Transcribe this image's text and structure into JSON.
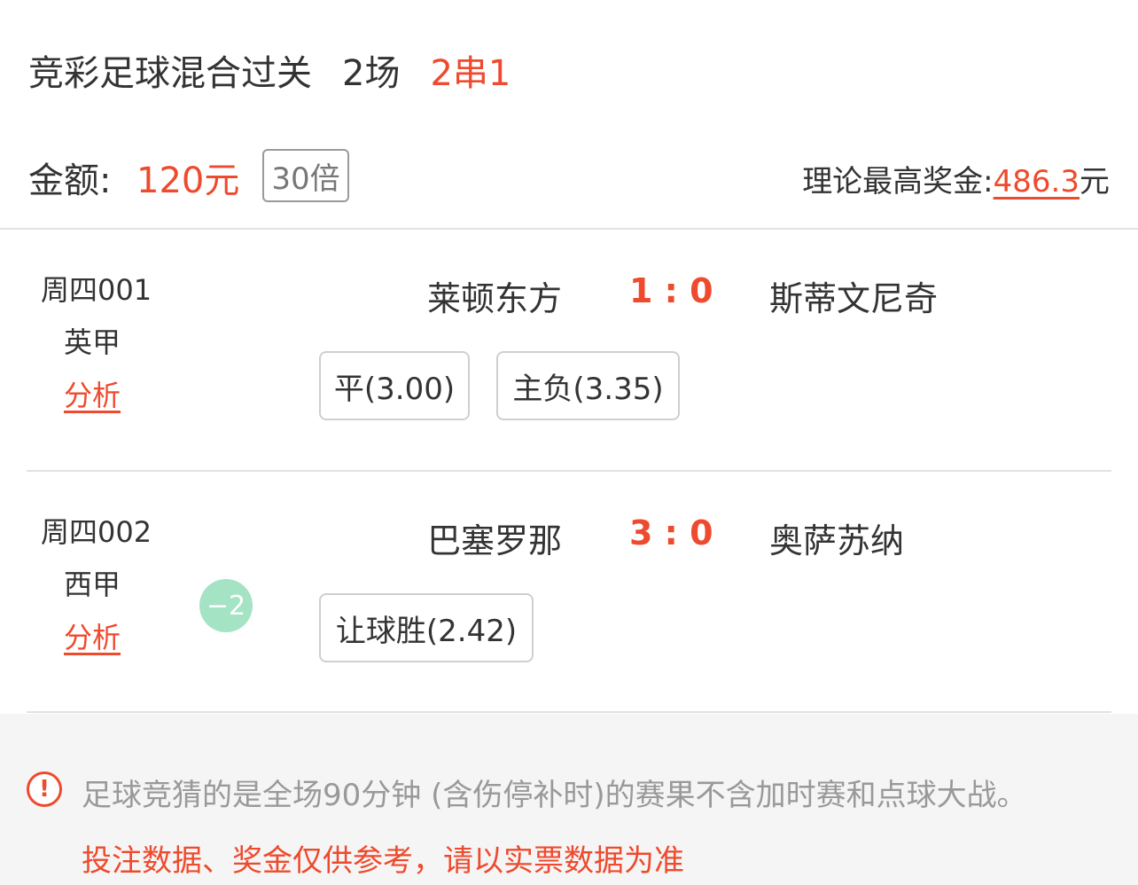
{
  "header": {
    "title": "竞彩足球混合过关",
    "match_count": "2场",
    "combo": "2串1"
  },
  "amount": {
    "label": "金额:",
    "value": "120元",
    "multiplier": "30倍",
    "prize_label": "理论最高奖金:",
    "prize_value": "486.3",
    "prize_unit": "元"
  },
  "matches": [
    {
      "match_no": "周四001",
      "league": "英甲",
      "analysis": "分析",
      "home": "莱顿东方",
      "score": "1 : 0",
      "away": "斯蒂文尼奇",
      "handicap": "",
      "bets": [
        "平(3.00)",
        "主负(3.35)"
      ]
    },
    {
      "match_no": "周四002",
      "league": "西甲",
      "analysis": "分析",
      "home": "巴塞罗那",
      "score": "3 : 0",
      "away": "奥萨苏纳",
      "handicap": "−2",
      "bets": [
        "让球胜(2.42)"
      ]
    }
  ],
  "notice": {
    "icon": "exclamation-circle-icon",
    "line1": "足球竞猜的是全场90分钟 (含伤停补时)的赛果不含加时赛和点球大战。",
    "line2": "投注数据、奖金仅供参考，请以实票数据为准"
  },
  "colors": {
    "accent": "#ee4a2d",
    "text": "#333333",
    "muted": "#999999",
    "badge": "#a4e3c4",
    "notice_bg": "#f5f5f5"
  }
}
